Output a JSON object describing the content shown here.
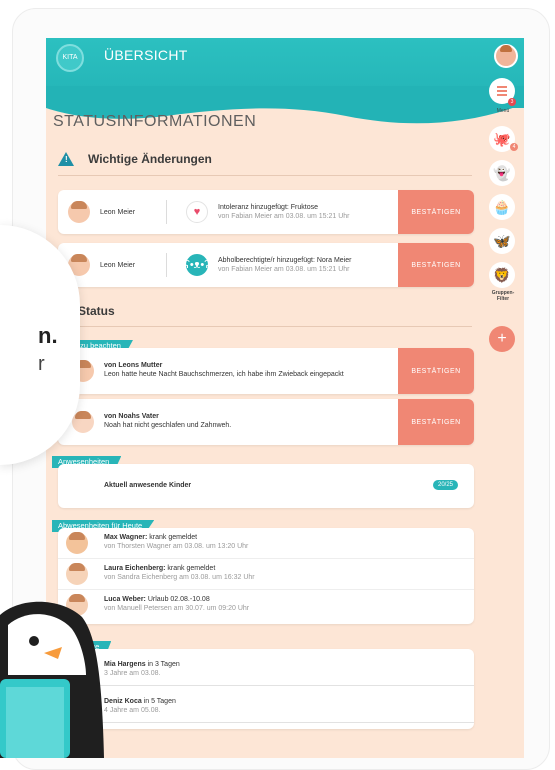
{
  "app": {
    "logo_text": "KITA",
    "title": "ÜBERSICHT"
  },
  "page_title": "STATUSINFORMATIONEN",
  "important": {
    "heading": "Wichtige Änderungen",
    "items": [
      {
        "name": "Leon Meier",
        "line1": "Intoleranz hinzugefügt: Fruktose",
        "line2": "von Fabian Meier am 03.08. um 15:21 Uhr",
        "icon": "heart-icon",
        "button": "BESTÄTIGEN"
      },
      {
        "name": "Leon Meier",
        "line1": "Abholberechtigte/r hinzugefügt: Nora Meier",
        "line2": "von Fabian Meier am 03.08. um 15:21 Uhr",
        "icon": "bear-icon",
        "button": "BESTÄTIGEN"
      }
    ]
  },
  "status": {
    "heading": "Status",
    "today_tag": "Heute zu beachten",
    "today_items": [
      {
        "title": "von Leons Mutter",
        "text": "Leon hatte heute Nacht Bauchschmerzen, ich habe ihm Zwieback eingepackt",
        "button": "BESTÄTIGEN"
      },
      {
        "title": "von Noahs Vater",
        "text": "Noah hat nicht geschlafen und Zahnweh.",
        "button": "BESTÄTIGEN"
      }
    ],
    "attendance_tag": "Anwesenheiten",
    "attendance_label": "Aktuell anwesende Kinder",
    "attendance_count": "20/25",
    "absence_tag": "Abwesenheiten für Heute",
    "absences": [
      {
        "bold": "Max Wagner:",
        "rest": " krank gemeldet",
        "sub": "von Thorsten Wagner am 03.08. um 13:20 Uhr"
      },
      {
        "bold": "Laura Eichenberg:",
        "rest": " krank gemeldet",
        "sub": "von Sandra Eichenberg am 03.08. um 16:32 Uhr"
      },
      {
        "bold": "Luca Weber:",
        "rest": " Urlaub 02.08.-10.08",
        "sub": "von Manuell Petersen am 30.07. um 09:20 Uhr"
      }
    ],
    "birthday_tag": "Geburtstage",
    "birthdays": [
      {
        "bold": "Mia Hargens",
        "rest": " in 3 Tagen",
        "sub": "3 Jahre am 03.08."
      },
      {
        "bold": "Deniz Koca",
        "rest": " in 5 Tagen",
        "sub": "4 Jahre am 05.08."
      }
    ]
  },
  "sidebar": {
    "menu_label": "Menü",
    "menu_badge": "3",
    "group_badge": "4",
    "group_filter_label": "Gruppen-\nFilter",
    "plus": "+"
  },
  "overlay": {
    "line1": "n.",
    "line2": "r"
  }
}
